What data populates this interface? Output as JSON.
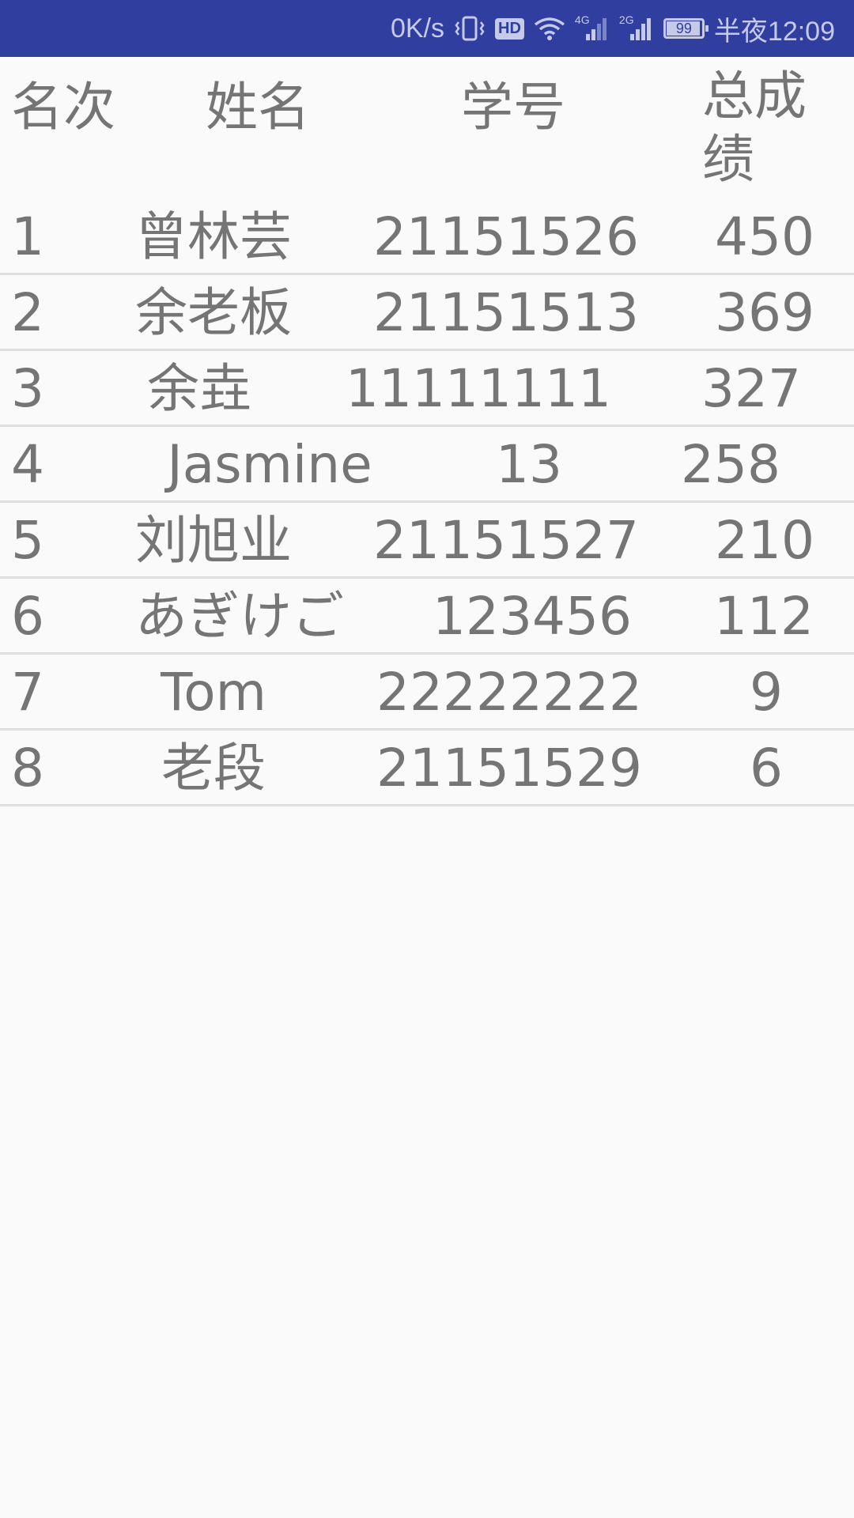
{
  "status_bar": {
    "net_speed": "0K/s",
    "hd": "HD",
    "signal_4g": "4G",
    "signal_2g": "2G",
    "battery": "99",
    "time": "半夜12:09"
  },
  "table": {
    "headers": {
      "rank": "名次",
      "name": "姓名",
      "student_id": "学号",
      "total_score": "总成绩"
    },
    "rows": [
      {
        "rank": "1",
        "name": "曾林芸",
        "student_id": "21151526",
        "score": "450"
      },
      {
        "rank": "2",
        "name": "余老板",
        "student_id": "21151513",
        "score": "369"
      },
      {
        "rank": "3",
        "name": "余垚",
        "student_id": "11111111",
        "score": "327"
      },
      {
        "rank": "4",
        "name": "Jasmine",
        "student_id": "13",
        "score": "258"
      },
      {
        "rank": "5",
        "name": "刘旭业",
        "student_id": "21151527",
        "score": "210"
      },
      {
        "rank": "6",
        "name": "あぎけご",
        "student_id": "123456",
        "score": "112"
      },
      {
        "rank": "7",
        "name": "Tom",
        "student_id": "22222222",
        "score": "9"
      },
      {
        "rank": "8",
        "name": "老段",
        "student_id": "21151529",
        "score": "6"
      }
    ]
  }
}
